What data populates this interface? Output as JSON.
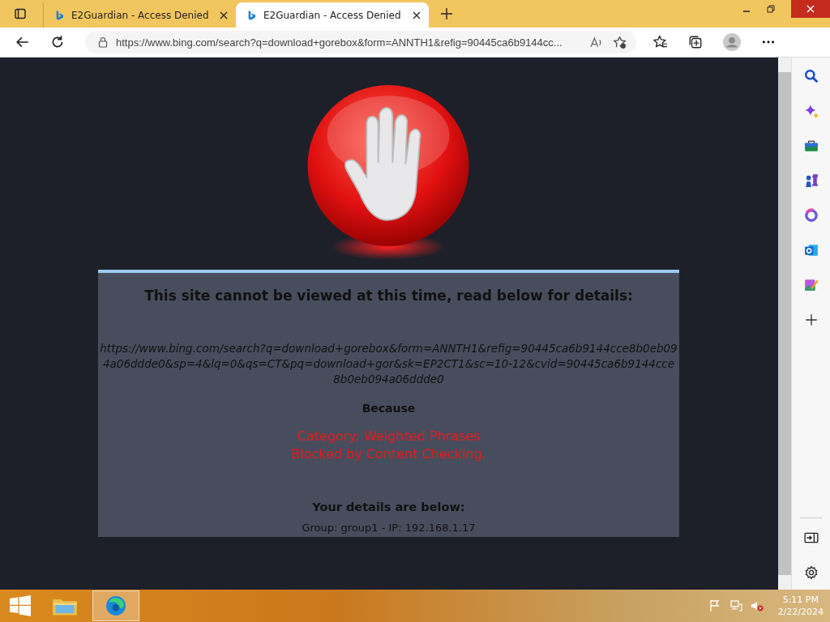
{
  "browser": {
    "tabs": [
      {
        "title": "E2Guardian - Access Denied",
        "selected": false
      },
      {
        "title": "E2Guardian - Access Denied",
        "selected": true
      }
    ],
    "address": "https://www.bing.com/search?q=download+gorebox&form=ANNTH1&refig=90445ca6b9144cc..."
  },
  "page": {
    "heading": "This site cannot be viewed at this time, read below for details:",
    "blocked_url": "https://www.bing.com/search?q=download+gorebox&form=ANNTH1&refig=90445ca6b9144cce8b0eb094a06ddde0&sp=4&lq=0&qs=CT&pq=download+gor&sk=EP2CT1&sc=10-12&cvid=90445ca6b9144cce8b0eb094a06ddde0",
    "because": "Because",
    "reasons": [
      "Category: Weighted Phrases",
      "Blocked by Content Checking."
    ],
    "details_heading": "Your details are below:",
    "details_line": "Group: group1 - IP: 192.168.1.17"
  },
  "taskbar": {
    "time": "5:11 PM",
    "date": "2/22/2024"
  }
}
